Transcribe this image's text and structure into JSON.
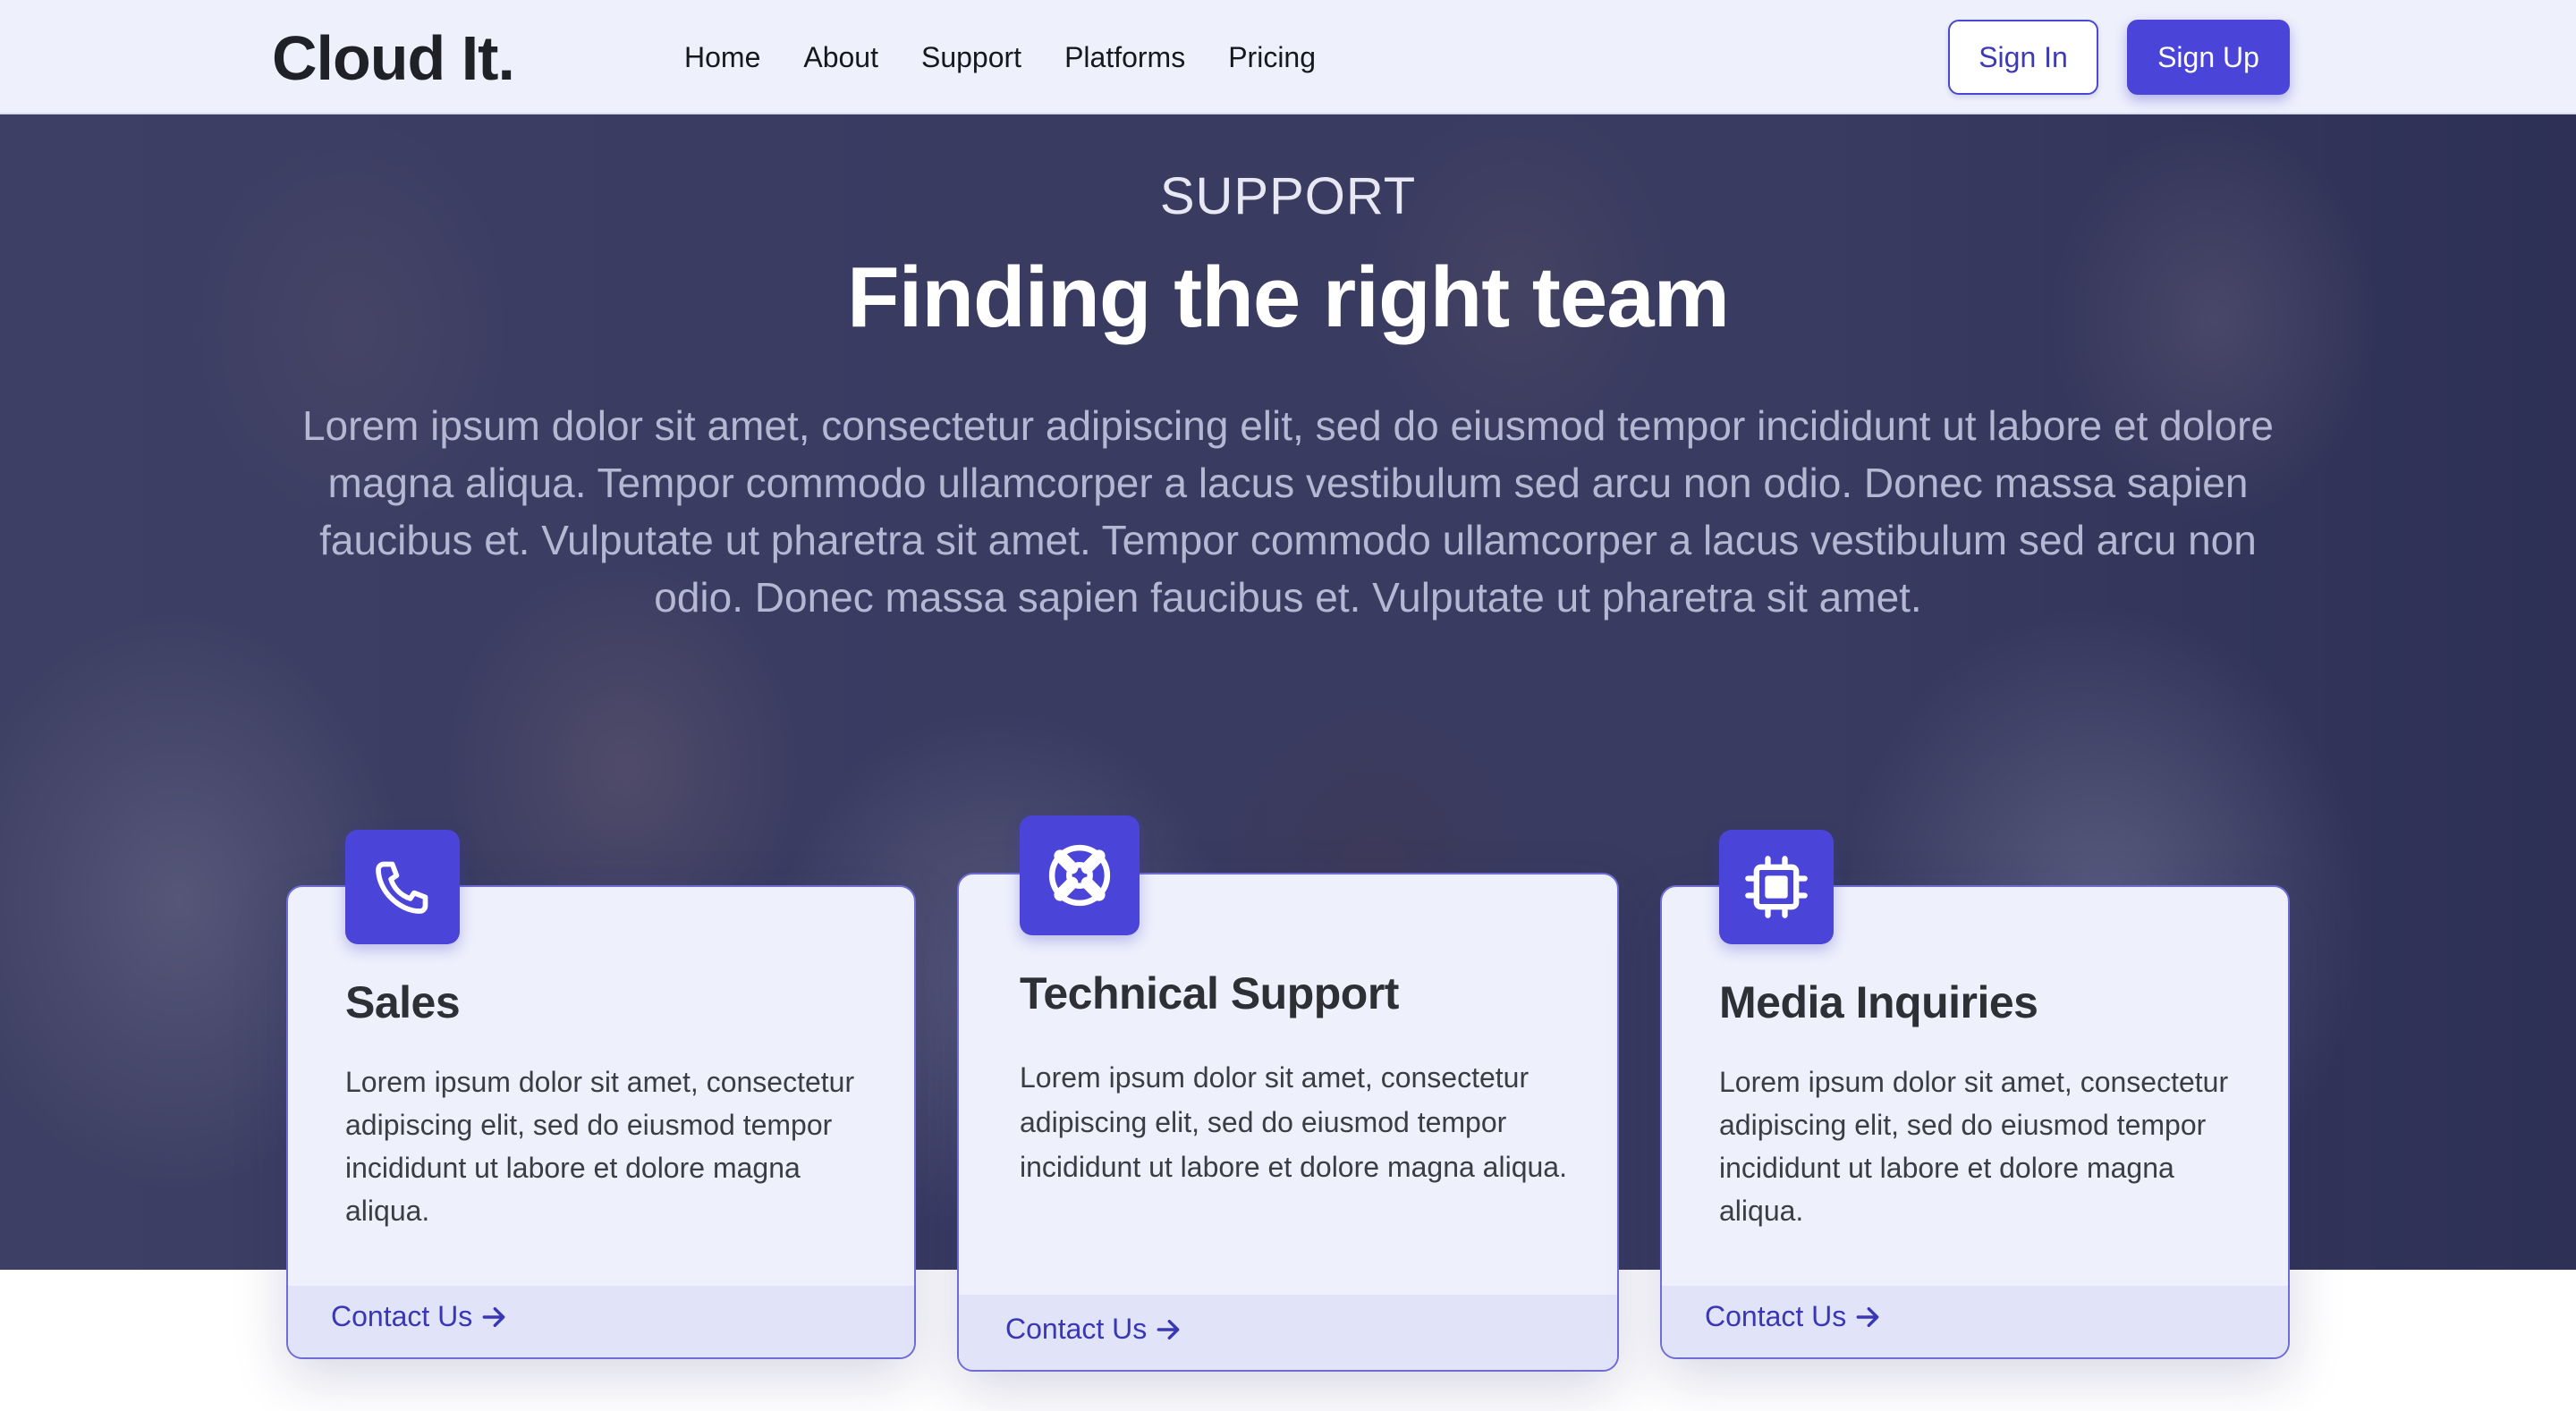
{
  "nav": {
    "logo": "Cloud It.",
    "links": [
      "Home",
      "About",
      "Support",
      "Platforms",
      "Pricing"
    ],
    "signin": "Sign In",
    "signup": "Sign Up"
  },
  "hero": {
    "eyebrow": "SUPPORT",
    "title": "Finding the right team",
    "text": "Lorem ipsum dolor sit amet, consectetur adipiscing elit, sed do eiusmod tempor incididunt ut labore et dolore magna aliqua. Tempor commodo ullamcorper a lacus vestibulum sed arcu non odio. Donec massa sapien faucibus et. Vulputate ut pharetra sit amet. Tempor commodo ullamcorper a lacus vestibulum sed arcu non odio. Donec massa sapien faucibus et. Vulputate ut pharetra sit amet."
  },
  "cards": [
    {
      "icon": "phone-icon",
      "title": "Sales",
      "text": "Lorem ipsum dolor sit amet, consectetur adipiscing elit, sed do eiusmod tempor incididunt ut labore et dolore magna aliqua.",
      "link": "Contact Us"
    },
    {
      "icon": "lifebuoy-icon",
      "title": "Technical Support",
      "text": "Lorem ipsum dolor sit amet, consectetur adipiscing elit, sed do eiusmod tempor incididunt ut labore et dolore magna aliqua.",
      "link": "Contact Us"
    },
    {
      "icon": "chip-icon",
      "title": "Media Inquiries",
      "text": "Lorem ipsum dolor sit amet, consectetur adipiscing elit, sed do eiusmod tempor incididunt ut labore et dolore magna aliqua.",
      "link": "Contact Us"
    }
  ],
  "colors": {
    "accent": "#4b44d8",
    "nav_bg": "#eef0fc",
    "card_bg": "#eef0fc",
    "link": "#3a37b5"
  }
}
